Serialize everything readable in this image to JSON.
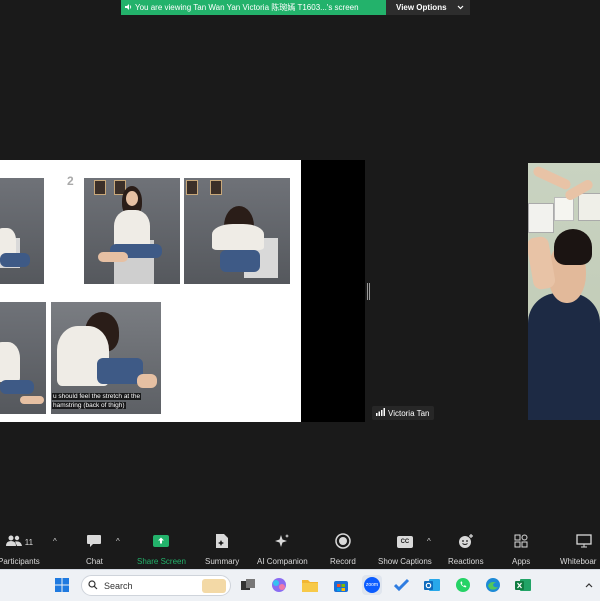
{
  "banner": {
    "message": "You are viewing Tan Wan Yan Victoria 陈琬嫣 T1603...'s screen",
    "view_options_label": "View Options",
    "icon": "speaker-icon"
  },
  "shared_screen": {
    "step_number": "2",
    "caption_line1": "u should feel the stretch at the",
    "caption_line2": "hamstring (back of thigh)"
  },
  "participant": {
    "name": "Victoria Tan",
    "icon": "signal-bars-icon"
  },
  "toolbar": {
    "participants_label": "Participants",
    "participants_count": "11",
    "chat_label": "Chat",
    "share_label": "Share Screen",
    "summary_label": "Summary",
    "ai_label": "AI Companion",
    "record_label": "Record",
    "captions_label": "Show Captions",
    "captions_icon_text": "CC",
    "reactions_label": "Reactions",
    "apps_label": "Apps",
    "whiteboards_label": "Whiteboar",
    "share_color": "#23b26b"
  },
  "taskbar": {
    "search_placeholder": "Search",
    "zoom_icon_text": "zoom"
  }
}
